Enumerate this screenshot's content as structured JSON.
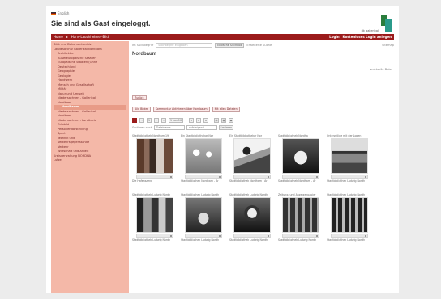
{
  "header": {
    "language": "English",
    "site_title": "Sie sind als Gast eingeloggt.",
    "logo_text": "dk gallerikal"
  },
  "topbar": {
    "left": [
      "Home",
      "Hans-Lauchheimer-Bild"
    ],
    "right": [
      "Login",
      "Kostenloses Login anlegen"
    ]
  },
  "sidebar": {
    "items": [
      {
        "label": "Bild- und Dokumentarchiv",
        "level": 0
      },
      {
        "label": "Landesarchiv Gallerikal Nordham",
        "level": 0
      },
      {
        "label": "Architektur",
        "level": 1
      },
      {
        "label": "Außereuropäische Staaten",
        "level": 1
      },
      {
        "label": "Europäische Staaten (Ohne",
        "level": 1
      },
      {
        "label": "Deutschland",
        "level": 1
      },
      {
        "label": "Geographie",
        "level": 1
      },
      {
        "label": "Geologie",
        "level": 1
      },
      {
        "label": "Handwerk",
        "level": 1
      },
      {
        "label": "Mensch und Gesellschaft",
        "level": 1
      },
      {
        "label": "Militär",
        "level": 1
      },
      {
        "label": "Natur und Umwelt",
        "level": 1
      },
      {
        "label": "Niedersachsen - Gallerikal",
        "level": 1
      },
      {
        "label": "Nordham",
        "level": 1
      },
      {
        "label": "Nordbaum",
        "level": 2,
        "active": true
      },
      {
        "label": "Niedersachsen - Gallerikal",
        "level": 1
      },
      {
        "label": "Nordham",
        "level": 1
      },
      {
        "label": "Niedersachsen - Landkreis",
        "level": 1
      },
      {
        "label": "Ortsbild",
        "level": 1
      },
      {
        "label": "Personendarstellung",
        "level": 1
      },
      {
        "label": "Sport",
        "level": 1
      },
      {
        "label": "Technik und",
        "level": 1
      },
      {
        "label": "Verkehrsgegenstände",
        "level": 1
      },
      {
        "label": "Verkehr",
        "level": 1
      },
      {
        "label": "Wirtschaft und Arbeit",
        "level": 1
      },
      {
        "label": "Kreisverwaltung NORDHA",
        "level": 0
      },
      {
        "label": "Lutze",
        "level": 0
      }
    ]
  },
  "search": {
    "label": "Im Suchbegriff",
    "placeholder": "Suchbegriff eingeben",
    "button": "Einfache Suchbox",
    "advanced": "Erweiterte Suche",
    "link": "Sitemap"
  },
  "page": {
    "heading": "Nordbaum",
    "versions_link": "aktuelle Datei",
    "back_button": "Zurück",
    "tabs": [
      "Alle Bilder",
      "Kommentar Aktivieren über Nordbaum",
      "Mit allen Dateien"
    ],
    "toolbar": [
      "«",
      "‹",
      "1",
      "›",
      "»",
      "1 von 16",
      "⊕",
      "⊖",
      "⌂",
      "▤",
      "▦",
      "▣"
    ],
    "sort_label": "Sortieren nach",
    "sort_value": "Dateiname",
    "sort_order": "aufsteigend",
    "sort_button": "Sortieren"
  },
  "thumbnails": [
    {
      "caption": "Stadtbibliothek Nordham 19",
      "sub": "Die Hafenszene"
    },
    {
      "caption": "Ein Stadtbibliothekar Nor",
      "sub": "Stadtbibliothek Nordham - Ar"
    },
    {
      "caption": "Ein Stadtbibliothekar Nor",
      "sub": "Stadtbibliothek Nordham - Ar"
    },
    {
      "caption": "Stadtbibliothek Nordha",
      "sub": "Stadtbibliothek Nordham - Ar"
    },
    {
      "caption": "Unterzeilige mit der Logen",
      "sub": "Stadtbibliothek Ludwig Nordh"
    },
    {
      "caption": "Stadtbibliothek Ludwig Nordh",
      "sub": "Stadtbibliothek Ludwig Nordh"
    },
    {
      "caption": "Stadtbibliothek Ludwig Nordh",
      "sub": "Stadtbibliothek Ludwig Nordh"
    },
    {
      "caption": "Stadtbibliothek Ludwig Nordh",
      "sub": "Stadtbibliothek Ludwig Nordh"
    },
    {
      "caption": "Zeitung- und Anzeigenpapier",
      "sub": "Stadtbibliothek Ludwig Nordh"
    },
    {
      "caption": "Stadtbibliothek Ludwig Nordh",
      "sub": "Stadtbibliothek Ludwig Nordh"
    }
  ]
}
